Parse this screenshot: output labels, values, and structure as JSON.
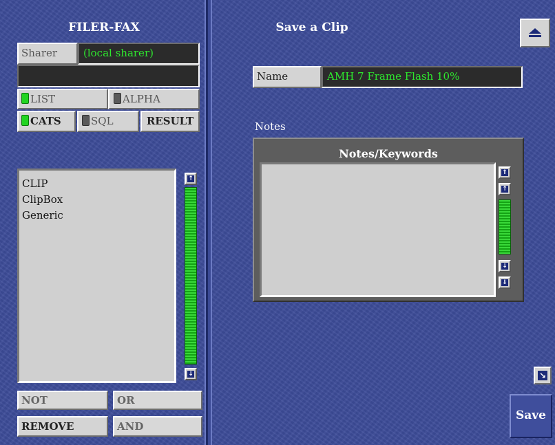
{
  "filer": {
    "title": "FILER-FAX",
    "sharer_label": "Sharer",
    "sharer_value": "(local sharer)",
    "search_value": "",
    "buttons": {
      "list": "LIST",
      "alpha": "ALPHA",
      "cats": "CATS",
      "sql": "SQL",
      "result": "RESULT",
      "not": "NOT",
      "or": "OR",
      "remove": "REMOVE",
      "and": "AND"
    },
    "indicators": {
      "list": "on",
      "alpha": "off",
      "cats": "on",
      "sql": "off"
    },
    "items": [
      {
        "label": "CLIP"
      },
      {
        "label": "ClipBox"
      },
      {
        "label": "Generic"
      }
    ]
  },
  "save": {
    "title": "Save a Clip",
    "name_label": "Name",
    "name_value": "AMH 7 Frame Flash 10%",
    "notes_label": "Notes",
    "notes_header": "Notes/Keywords",
    "notes_value": "",
    "save_button": "Save"
  },
  "icons": {
    "eject": "eject-icon",
    "scroll_up": "arrow-up-icon",
    "scroll_down": "arrow-down-icon",
    "page_up": "double-arrow-up-icon",
    "page_down": "double-arrow-down-icon",
    "corner": "arrow-down-right-icon"
  },
  "colors": {
    "background": "#3d4c99",
    "field_text": "#2ee82e",
    "indicator_on": "#22d422"
  }
}
